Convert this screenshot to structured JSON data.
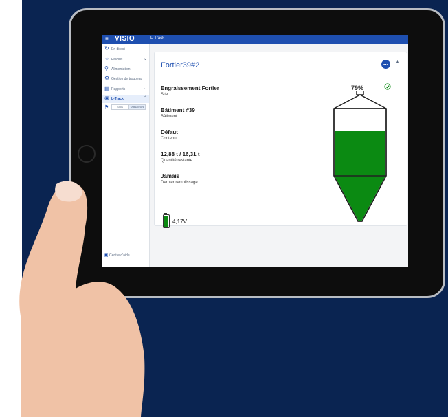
{
  "app": {
    "logo": "VISIO",
    "breadcrumb": "L-Track"
  },
  "sidebar": {
    "items": [
      {
        "label": "En direct",
        "icon": "live-icon"
      },
      {
        "label": "Favoris",
        "icon": "star-icon"
      },
      {
        "label": "Alimentation",
        "icon": "feed-icon"
      },
      {
        "label": "Gestion de troupeau",
        "icon": "herd-icon"
      },
      {
        "label": "Rapports",
        "icon": "report-icon"
      },
      {
        "label": "L-Track",
        "icon": "ltrack-icon",
        "active": true
      }
    ],
    "segment": [
      "Silos",
      "Utilisateurs"
    ],
    "help_label": "Centre d'aide"
  },
  "silo_card": {
    "title": "Fortier39#2",
    "fields": [
      {
        "value": "Engraissement Fortier",
        "key": "Site"
      },
      {
        "value": "Bâtiment #39",
        "key": "Bâtiment"
      },
      {
        "value": "Défaut",
        "key": "Contenu"
      },
      {
        "value": "12,88 t / 16,31 t",
        "key": "Quantité restante"
      },
      {
        "value": "Jamais",
        "key": "Dernier remplissage"
      }
    ],
    "fill_percent": "79%",
    "fill_fraction": 0.79,
    "battery_voltage": "4,17V",
    "status": "ok-check-icon",
    "fill_color": "#0b8a12"
  },
  "colors": {
    "accent": "#1e4fb0",
    "background": "#0a2451"
  }
}
